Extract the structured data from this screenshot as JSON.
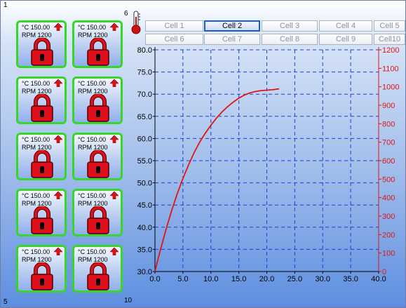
{
  "corners": {
    "top_left": "1",
    "top_mid": "6",
    "bottom_left": "5",
    "bottom_mid": "10"
  },
  "tiles": [
    {
      "temp": "°C 150.00",
      "rpm": "RPM 1200"
    },
    {
      "temp": "°C 150.00",
      "rpm": "RPM 1200"
    },
    {
      "temp": "°C 150.00",
      "rpm": "RPM 1200"
    },
    {
      "temp": "°C 150.00",
      "rpm": "RPM 1200"
    },
    {
      "temp": "°C 150.00",
      "rpm": "RPM 1200"
    },
    {
      "temp": "°C 150.00",
      "rpm": "RPM 1200"
    },
    {
      "temp": "°C 150.00",
      "rpm": "RPM 1200"
    },
    {
      "temp": "°C 150.00",
      "rpm": "RPM 1200"
    },
    {
      "temp": "°C 150.00",
      "rpm": "RPM 1200"
    },
    {
      "temp": "°C 150.00",
      "rpm": "RPM 1200"
    }
  ],
  "tabs": [
    {
      "label": "Cell 1"
    },
    {
      "label": "Cell 2"
    },
    {
      "label": "Cell 3"
    },
    {
      "label": "Cell 4"
    },
    {
      "label": "Cell 5"
    },
    {
      "label": "Cell 6"
    },
    {
      "label": "Cell 7"
    },
    {
      "label": "Cell 8"
    },
    {
      "label": "Cell 9"
    },
    {
      "label": "Cell10"
    }
  ],
  "active_tab": "Cell 2",
  "colors": {
    "tile_border": "#38d629",
    "lock": "#e0101a",
    "curve": "#e01515",
    "grid": "#1c3fd6",
    "right_axis": "#e01515"
  },
  "icons": {
    "tile_status": "red-up-arrow-icon",
    "tile_lock": "red-padlock-icon",
    "header": "thermometer-icon"
  },
  "chart_data": {
    "type": "line",
    "x_ticks": [
      "0.0",
      "5.0",
      "10.0",
      "15.0",
      "20.0",
      "25.0",
      "30.0",
      "35.0",
      "40.0"
    ],
    "y_ticks_left": [
      "80.0",
      "75.0",
      "70.0",
      "65.0",
      "60.0",
      "55.0",
      "50.0",
      "45.0",
      "40.0",
      "35.0",
      "30.0"
    ],
    "y_ticks_right": [
      "1200",
      "1100",
      "1000",
      "900",
      "800",
      "700",
      "600",
      "500",
      "400",
      "300",
      "200",
      "100",
      "0"
    ],
    "xlim": [
      0,
      40
    ],
    "ylim_left": [
      30,
      80
    ],
    "ylim_right": [
      0,
      1200
    ],
    "grid": true,
    "series": [
      {
        "axis": "left",
        "x": [
          0,
          0.5,
          1,
          2,
          3,
          4,
          5,
          6,
          7,
          8,
          9,
          10,
          11,
          12,
          13,
          14,
          15,
          16,
          17,
          18,
          19,
          20,
          21,
          22.2
        ],
        "y": [
          30.0,
          32.6,
          35.0,
          39.6,
          43.8,
          47.6,
          51.0,
          54.0,
          56.8,
          59.2,
          61.2,
          63.0,
          64.6,
          66.0,
          67.2,
          68.2,
          69.1,
          69.8,
          70.3,
          70.6,
          70.8,
          70.9,
          71.0,
          71.2
        ]
      }
    ]
  }
}
